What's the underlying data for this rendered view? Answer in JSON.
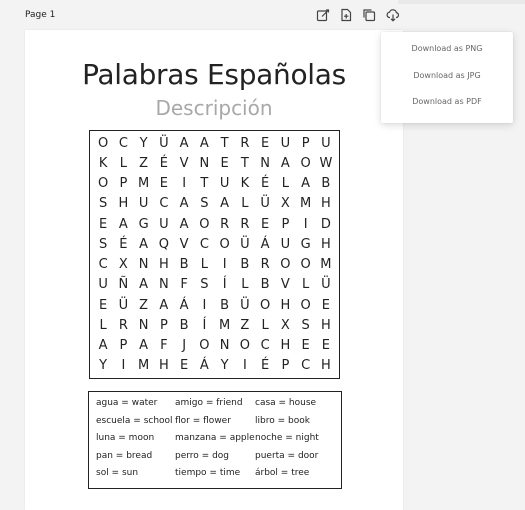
{
  "page_label": "Page 1",
  "toolbar": {
    "icons": [
      "edit-icon",
      "add-page-icon",
      "duplicate-icon",
      "download-icon"
    ]
  },
  "document": {
    "title": "Palabras Españolas",
    "subtitle": "Descripción",
    "grid": [
      [
        "O",
        "C",
        "Y",
        "Ü",
        "A",
        "A",
        "T",
        "R",
        "E",
        "U",
        "P",
        "U"
      ],
      [
        "K",
        "L",
        "Z",
        "É",
        "V",
        "N",
        "E",
        "T",
        "N",
        "A",
        "O",
        "W"
      ],
      [
        "O",
        "P",
        "M",
        "E",
        "I",
        "T",
        "U",
        "K",
        "É",
        "L",
        "A",
        "B"
      ],
      [
        "S",
        "H",
        "U",
        "C",
        "A",
        "S",
        "A",
        "L",
        "Ü",
        "X",
        "M",
        "H"
      ],
      [
        "E",
        "A",
        "G",
        "U",
        "A",
        "O",
        "R",
        "R",
        "E",
        "P",
        "I",
        "D"
      ],
      [
        "S",
        "É",
        "A",
        "Q",
        "V",
        "C",
        "O",
        "Ü",
        "Á",
        "U",
        "G",
        "H"
      ],
      [
        "C",
        "X",
        "N",
        "H",
        "B",
        "L",
        "I",
        "B",
        "R",
        "O",
        "O",
        "M"
      ],
      [
        "U",
        "Ñ",
        "A",
        "N",
        "F",
        "S",
        "Í",
        "L",
        "B",
        "V",
        "L",
        "Ü"
      ],
      [
        "E",
        "Ü",
        "Z",
        "A",
        "Á",
        "I",
        "B",
        "Ü",
        "O",
        "H",
        "O",
        "E"
      ],
      [
        "L",
        "R",
        "N",
        "P",
        "B",
        "Í",
        "M",
        "Z",
        "L",
        "X",
        "S",
        "H"
      ],
      [
        "A",
        "P",
        "A",
        "F",
        "J",
        "O",
        "N",
        "O",
        "C",
        "H",
        "E",
        "E"
      ],
      [
        "Y",
        "I",
        "M",
        "H",
        "E",
        "Á",
        "Y",
        "I",
        "É",
        "P",
        "C",
        "H"
      ]
    ],
    "word_list": [
      "agua = water",
      "amigo = friend",
      "casa = house",
      "escuela = school",
      "flor = flower",
      "libro = book",
      "luna = moon",
      "manzana = apple",
      "noche = night",
      "pan = bread",
      "perro = dog",
      "puerta = door",
      "sol = sun",
      "tiempo = time",
      "árbol = tree"
    ]
  },
  "download_menu": {
    "items": [
      "Download as PNG",
      "Download as JPG",
      "Download as PDF"
    ]
  }
}
